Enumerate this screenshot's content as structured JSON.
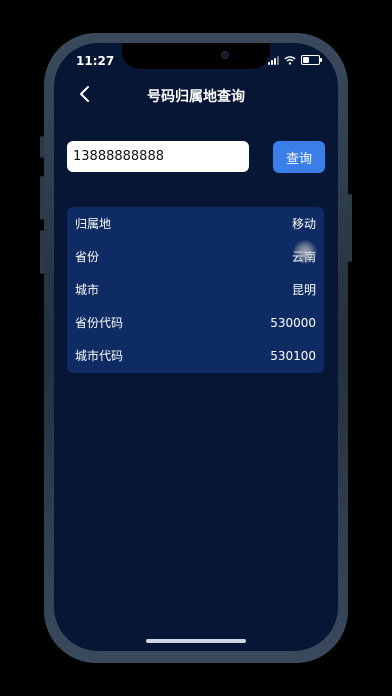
{
  "status_bar": {
    "time": "11:27"
  },
  "nav": {
    "title": "号码归属地查询"
  },
  "search": {
    "value": "13888888888",
    "button_label": "查询"
  },
  "result_rows": [
    {
      "label": "归属地",
      "value": "移动"
    },
    {
      "label": "省份",
      "value": "云南"
    },
    {
      "label": "城市",
      "value": "昆明"
    },
    {
      "label": "省份代码",
      "value": "530000"
    },
    {
      "label": "城市代码",
      "value": "530100"
    }
  ],
  "icons": {
    "back": "chevron-left-icon",
    "signal": "cellular-signal-icon",
    "wifi": "wifi-icon",
    "battery": "battery-icon"
  },
  "colors": {
    "background": "#061634",
    "card": "#0f2b63",
    "button": "#3a7ee8"
  }
}
